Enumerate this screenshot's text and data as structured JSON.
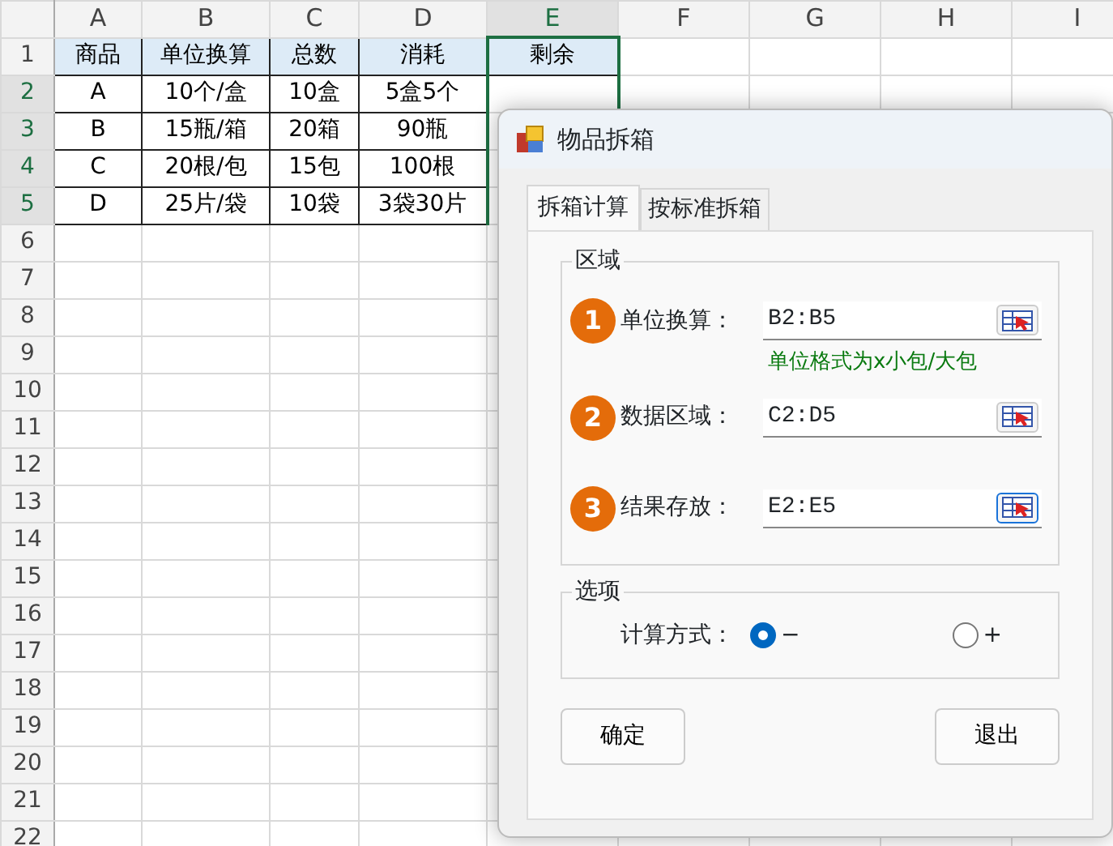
{
  "sheet": {
    "columns": [
      {
        "label": "A",
        "selected": false
      },
      {
        "label": "B",
        "selected": false
      },
      {
        "label": "C",
        "selected": false
      },
      {
        "label": "D",
        "selected": false
      },
      {
        "label": "E",
        "selected": true
      },
      {
        "label": "F",
        "selected": false
      },
      {
        "label": "G",
        "selected": false
      },
      {
        "label": "H",
        "selected": false
      },
      {
        "label": "I",
        "selected": false
      }
    ],
    "rows": [
      {
        "number": "1",
        "selected": false,
        "kind": "header",
        "cells": [
          "商品",
          "单位换算",
          "总数",
          "消耗",
          "剩余"
        ]
      },
      {
        "number": "2",
        "selected": true,
        "kind": "data",
        "cells": [
          "A",
          "10个/盒",
          "10盒",
          "5盒5个"
        ]
      },
      {
        "number": "3",
        "selected": true,
        "kind": "data",
        "cells": [
          "B",
          "15瓶/箱",
          "20箱",
          "90瓶"
        ]
      },
      {
        "number": "4",
        "selected": true,
        "kind": "data",
        "cells": [
          "C",
          "20根/包",
          "15包",
          "100根"
        ]
      },
      {
        "number": "5",
        "selected": true,
        "kind": "data",
        "cells": [
          "D",
          "25片/袋",
          "10袋",
          "3袋30片"
        ]
      },
      {
        "number": "6",
        "selected": false,
        "kind": "empty",
        "cells": []
      },
      {
        "number": "7",
        "selected": false,
        "kind": "empty",
        "cells": []
      },
      {
        "number": "8",
        "selected": false,
        "kind": "empty",
        "cells": []
      },
      {
        "number": "9",
        "selected": false,
        "kind": "empty",
        "cells": []
      },
      {
        "number": "10",
        "selected": false,
        "kind": "empty",
        "cells": []
      },
      {
        "number": "11",
        "selected": false,
        "kind": "empty",
        "cells": []
      },
      {
        "number": "12",
        "selected": false,
        "kind": "empty",
        "cells": []
      },
      {
        "number": "13",
        "selected": false,
        "kind": "empty",
        "cells": []
      },
      {
        "number": "14",
        "selected": false,
        "kind": "empty",
        "cells": []
      },
      {
        "number": "15",
        "selected": false,
        "kind": "empty",
        "cells": []
      },
      {
        "number": "16",
        "selected": false,
        "kind": "empty",
        "cells": []
      },
      {
        "number": "17",
        "selected": false,
        "kind": "empty",
        "cells": []
      },
      {
        "number": "18",
        "selected": false,
        "kind": "empty",
        "cells": []
      },
      {
        "number": "19",
        "selected": false,
        "kind": "empty",
        "cells": []
      },
      {
        "number": "20",
        "selected": false,
        "kind": "empty",
        "cells": []
      },
      {
        "number": "21",
        "selected": false,
        "kind": "empty",
        "cells": []
      },
      {
        "number": "22",
        "selected": false,
        "kind": "empty",
        "cells": []
      }
    ]
  },
  "dialog": {
    "title": "物品拆箱",
    "tabs": [
      {
        "label": "拆箱计算",
        "selected": true
      },
      {
        "label": "按标准拆箱",
        "selected": false
      }
    ],
    "range_group": {
      "title": "区域",
      "fields": [
        {
          "badge": "1",
          "label": "单位换算：",
          "value": "B2:B5",
          "hint": "单位格式为x小包/大包",
          "focused": false
        },
        {
          "badge": "2",
          "label": "数据区域：",
          "value": "C2:D5",
          "focused": false
        },
        {
          "badge": "3",
          "label": "结果存放：",
          "value": "E2:E5",
          "focused": true
        }
      ]
    },
    "options_group": {
      "title": "选项",
      "label": "计算方式：",
      "options": [
        {
          "label": "−",
          "selected": true
        },
        {
          "label": "+",
          "selected": false
        }
      ]
    },
    "buttons": [
      "确定",
      "退出"
    ]
  }
}
